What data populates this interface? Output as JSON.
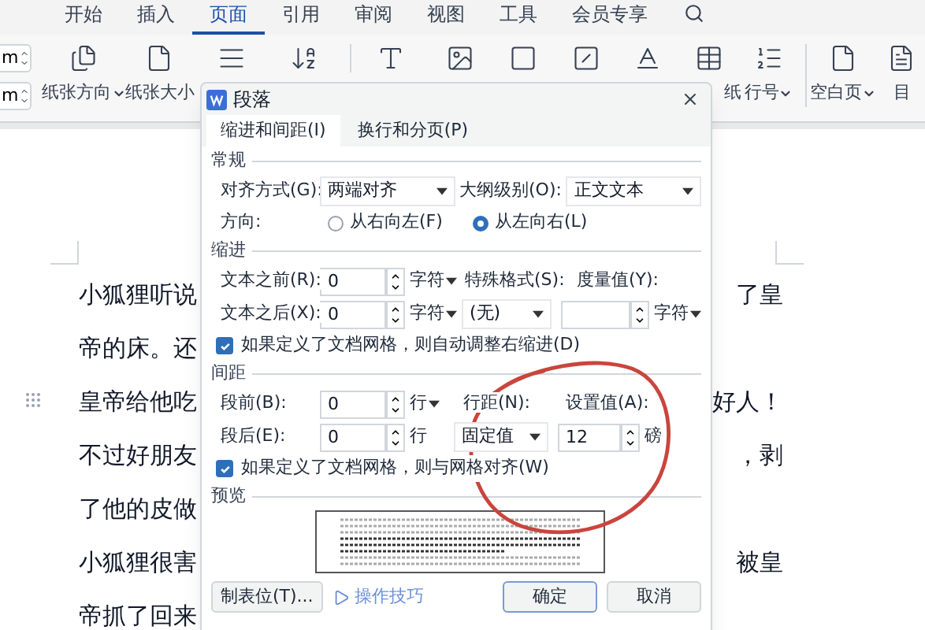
{
  "menu_tabs": [
    {
      "label": "开始",
      "selected": false
    },
    {
      "label": "插入",
      "selected": false
    },
    {
      "label": "页面",
      "selected": true
    },
    {
      "label": "引用",
      "selected": false
    },
    {
      "label": "审阅",
      "selected": false
    },
    {
      "label": "视图",
      "selected": false
    },
    {
      "label": "工具",
      "selected": false
    },
    {
      "label": "会员专享",
      "selected": false
    }
  ],
  "ribbon": {
    "spin_fields": [
      {
        "value": "m"
      },
      {
        "value": "m"
      }
    ],
    "tools": [
      {
        "label": "纸张方向",
        "dropdown": true
      },
      {
        "label": "纸张大小",
        "dropdown": false
      },
      {
        "dropdown": false
      },
      {
        "dropdown": false
      },
      {
        "dropdown": false
      },
      {
        "dropdown": false
      },
      {
        "dropdown": false
      },
      {
        "dropdown": false
      },
      {
        "dropdown": false
      },
      {
        "label": "纸",
        "dropdown": false
      },
      {
        "label": "行号",
        "dropdown": true
      },
      {
        "label": "空白页",
        "dropdown": true
      },
      {
        "label": "目",
        "dropdown": false
      }
    ]
  },
  "document": {
    "lines": [
      {
        "left": "小狐狸听说",
        "right": "了皇"
      },
      {
        "left": "帝的床。还"
      },
      {
        "left": "皇帝给他吃",
        "right": "好人！"
      },
      {
        "left": "不过好朋友",
        "right": "，剥"
      },
      {
        "left": "了他的皮做"
      },
      {
        "left": "小狐狸很害",
        "right": "被皇"
      },
      {
        "left": "帝抓了回来"
      }
    ]
  },
  "dialog": {
    "title": "段落",
    "tabs": [
      {
        "label": "缩进和间距(I)",
        "selected": true
      },
      {
        "label": "换行和分页(P)",
        "selected": false
      }
    ],
    "general": {
      "heading": "常规",
      "alignment": {
        "label": "对齐方式(G):",
        "value": "两端对齐"
      },
      "outline_level": {
        "label": "大纲级别(O):",
        "value": "正文文本"
      },
      "direction": {
        "label": "方向:",
        "options": [
          {
            "label": "从右向左(F)",
            "selected": false
          },
          {
            "label": "从左向右(L)",
            "selected": true
          }
        ]
      }
    },
    "indent": {
      "heading": "缩进",
      "before": {
        "label": "文本之前(R):",
        "value": "0",
        "unit": "字符"
      },
      "after": {
        "label": "文本之后(X):",
        "value": "0",
        "unit": "字符"
      },
      "special": {
        "label": "特殊格式(S):",
        "value": "(无)"
      },
      "measure": {
        "label": "度量值(Y):",
        "unit": "字符"
      },
      "auto_adjust": {
        "label": "如果定义了文档网格，则自动调整右缩进(D)",
        "checked": true
      }
    },
    "spacing": {
      "heading": "间距",
      "before": {
        "label": "段前(B):",
        "value": "0",
        "unit": "行"
      },
      "after": {
        "label": "段后(E):",
        "value": "0",
        "unit": "行"
      },
      "line_spacing": {
        "label": "行距(N):",
        "value": "固定值"
      },
      "set_value": {
        "label": "设置值(A):",
        "value": "12",
        "unit": "磅"
      },
      "snap_to_grid": {
        "label": "如果定义了文档网格，则与网格对齐(W)",
        "checked": true
      }
    },
    "preview": {
      "heading": "预览"
    },
    "buttons": {
      "tab_stops": "制表位(T)...",
      "tips": "操作技巧",
      "ok": "确定",
      "cancel": "取消"
    }
  }
}
